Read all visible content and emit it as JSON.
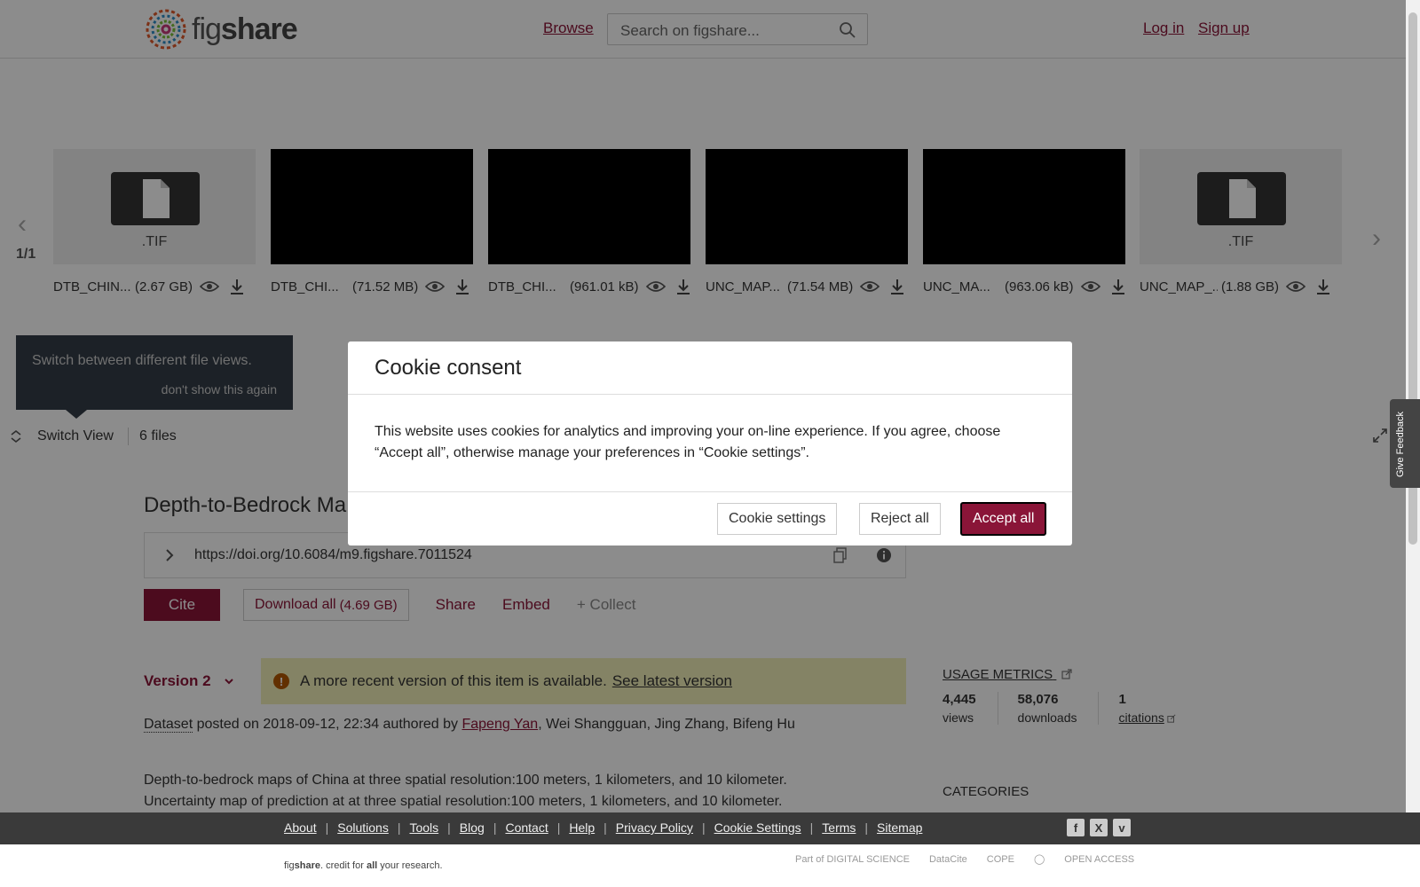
{
  "header": {
    "brand_light": "fig",
    "brand_bold": "share",
    "browse": "Browse",
    "search_placeholder": "Search on figshare...",
    "login": "Log in",
    "signup": "Sign up"
  },
  "carousel": {
    "counter": "1/1",
    "files": [
      {
        "name": "DTB_CHIN...",
        "size": "(2.67 GB)",
        "thumb": "doc",
        "ext": ".TIF"
      },
      {
        "name": "DTB_CHI...",
        "size": "(71.52 MB)",
        "thumb": "black",
        "ext": ""
      },
      {
        "name": "DTB_CHI...",
        "size": "(961.01 kB)",
        "thumb": "black",
        "ext": ""
      },
      {
        "name": "UNC_MAP...",
        "size": "(71.54 MB)",
        "thumb": "black",
        "ext": ""
      },
      {
        "name": "UNC_MA...",
        "size": "(963.06 kB)",
        "thumb": "black",
        "ext": ""
      },
      {
        "name": "UNC_MAP_...",
        "size": "(1.88 GB)",
        "thumb": "doc",
        "ext": ".TIF"
      }
    ]
  },
  "tooltip": {
    "text": "Switch between different file views.",
    "dismiss": "don't show this again"
  },
  "switchbar": {
    "switch_view": "Switch View",
    "files_count": "6 files"
  },
  "item": {
    "title": "Depth-to-Bedrock Ma",
    "doi": "https://doi.org/10.6084/m9.figshare.7011524",
    "cite": "Cite",
    "download": "Download all",
    "download_size": "(4.69 GB)",
    "share": "Share",
    "embed": "Embed",
    "collect": "+ Collect",
    "version": "Version 2",
    "notice": "A more recent version of this item is available.",
    "notice_link": "See latest version",
    "type": "Dataset",
    "posted": " posted on 2018-09-12, 22:34 authored by ",
    "first_author": "Fapeng Yan",
    "other_authors": ", Wei Shangguan, Jing Zhang, Bifeng Hu",
    "desc_line1": "Depth-to-bedrock maps of China at three spatial resolution:100 meters, 1 kilometers, and 10 kilometer.",
    "desc_line2": "Uncertainty map of prediction at at three spatial resolution:100 meters, 1 kilometers, and 10 kilometer."
  },
  "metrics": {
    "title": "USAGE METRICS",
    "views": "4,445",
    "views_label": "views",
    "downloads": "58,076",
    "downloads_label": "downloads",
    "citations": "1",
    "citations_label": "citations",
    "categories": "CATEGORIES"
  },
  "feedback": "Give Feedback",
  "modal": {
    "title": "Cookie consent",
    "body": "This website uses cookies for analytics and improving your on-line experience. If you agree, choose “Accept all”, otherwise manage your preferences in “Cookie settings”.",
    "cookie_settings": "Cookie settings",
    "reject": "Reject all",
    "accept": "Accept all"
  },
  "footer": {
    "links": [
      "About",
      "Solutions",
      "Tools",
      "Blog",
      "Contact",
      "Help",
      "Privacy Policy",
      "Cookie Settings",
      "Terms",
      "Sitemap"
    ],
    "tagline_brand_light": "fig",
    "tagline_brand_bold": "share",
    "tagline_rest": ". credit for ",
    "tagline_all": "all",
    "tagline_end": " your research.",
    "partners": [
      "Part of DIGITAL SCIENCE",
      "DataCite",
      "COPE",
      "",
      "OPEN ACCESS"
    ]
  },
  "colors": {
    "brand": "#8a1538",
    "notice_bg": "#f1efb8",
    "footer_bg": "#3a3a3a"
  }
}
